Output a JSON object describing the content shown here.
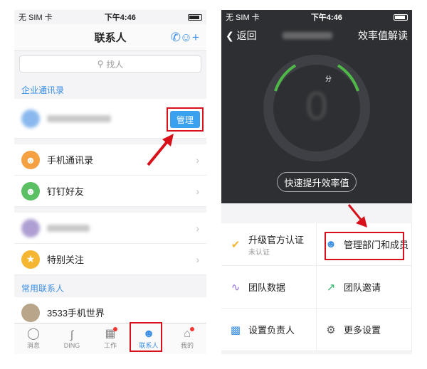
{
  "left": {
    "status": {
      "carrier": "无 SIM 卡",
      "time": "下午4:46"
    },
    "title": "联系人",
    "search_placeholder": "找人",
    "enterprise_label": "企业通讯录",
    "manage_label": "管理",
    "rows": [
      {
        "label": "手机通讯录",
        "icon": "person-icon",
        "color": "#f5a142"
      },
      {
        "label": "钉钉好友",
        "icon": "person-icon",
        "color": "#5bbf63"
      },
      {
        "label": "特别关注",
        "icon": "star-icon",
        "color": "#f5b731"
      }
    ],
    "common_label": "常用联系人",
    "contact": "3533手机世界",
    "tabs": [
      {
        "label": "消息",
        "icon": "chat-icon"
      },
      {
        "label": "DING",
        "icon": "ding-icon"
      },
      {
        "label": "工作",
        "icon": "grid-icon"
      },
      {
        "label": "联系人",
        "icon": "contacts-icon"
      },
      {
        "label": "我的",
        "icon": "home-icon"
      }
    ]
  },
  "right": {
    "status": {
      "carrier": "无 SIM 卡",
      "time": "下午4:46"
    },
    "back_label": "返回",
    "nav_right": "效率值解读",
    "score_unit": "分",
    "quick_label": "快速提升效率值",
    "cells": [
      {
        "label": "升级官方认证",
        "sub": "未认证",
        "icon": "check-icon",
        "color": "#f5b731"
      },
      {
        "label": "管理部门和成员",
        "icon": "person-icon",
        "color": "#3a8ee6"
      },
      {
        "label": "团队数据",
        "icon": "chart-icon",
        "color": "#8f6fd6"
      },
      {
        "label": "团队邀请",
        "icon": "share-icon",
        "color": "#2fb96d"
      },
      {
        "label": "设置负责人",
        "icon": "sofa-icon",
        "color": "#3a8ee6"
      },
      {
        "label": "更多设置",
        "icon": "gear-icon",
        "color": "#555555"
      }
    ]
  },
  "colors": {
    "accent": "#3a8ee6",
    "highlight": "#d8101a",
    "dark_bg": "#2d2f33"
  }
}
